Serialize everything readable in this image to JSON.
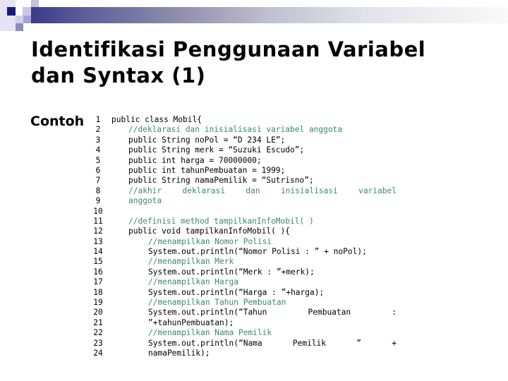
{
  "slide": {
    "title_lines": [
      "Identifikasi Penggunaan Variabel",
      "dan Syntax (1)"
    ],
    "bullet_label": "Contoh",
    "colors": {
      "accent_dark": "#1a1a7a",
      "accent_light": "#c8c8e8",
      "comment": "#3c8a6a"
    }
  },
  "code": {
    "lines": [
      {
        "n": "1",
        "text": "public class Mobil{",
        "type": "code",
        "indent": 0
      },
      {
        "n": "2",
        "text": "//deklarasi dan inisialisasi variabel anggota",
        "type": "comment",
        "indent": 1
      },
      {
        "n": "3",
        "text": "public String noPol = “D 234 LE”;",
        "type": "code",
        "indent": 1
      },
      {
        "n": "4",
        "text": "public String merk = “Suzuki Escudo”;",
        "type": "code",
        "indent": 1
      },
      {
        "n": "5",
        "text": "public int harga = 70000000;",
        "type": "code",
        "indent": 1
      },
      {
        "n": "6",
        "text": "public int tahunPembuatan = 1999;",
        "type": "code",
        "indent": 1
      },
      {
        "n": "7",
        "text": "public String namaPemilik = “Sutrisno”;",
        "type": "code",
        "indent": 1
      },
      {
        "n": "8",
        "text": "//akhir deklarasi dan inisialisasi variabel",
        "type": "comment-justify",
        "indent": 1,
        "parts": [
          "//akhir",
          "deklarasi",
          "dan",
          "inisialisasi",
          "variabel"
        ]
      },
      {
        "n": "9",
        "text": "anggota",
        "type": "comment",
        "indent": 1
      },
      {
        "n": "10",
        "text": "",
        "type": "code",
        "indent": 1
      },
      {
        "n": "11",
        "text": "//definisi method tampilkanInfoMobil( )",
        "type": "comment",
        "indent": 1
      },
      {
        "n": "12",
        "text": "public void tampilkanInfoMobil( ){",
        "type": "code",
        "indent": 1
      },
      {
        "n": "13",
        "text": "//menampilkan Nomor Polisi",
        "type": "comment",
        "indent": 2
      },
      {
        "n": "14",
        "text": "System.out.println(“Nomor Polisi : ” + noPol);",
        "type": "code",
        "indent": 2
      },
      {
        "n": "15",
        "text": "//menampilkan Merk",
        "type": "comment",
        "indent": 2
      },
      {
        "n": "16",
        "text": "System.out.println(“Merk : ”+merk);",
        "type": "code",
        "indent": 2
      },
      {
        "n": "17",
        "text": "//menampilkan Harga",
        "type": "comment",
        "indent": 2
      },
      {
        "n": "18",
        "text": "System.out.println(“Harga : ”+harga);",
        "type": "code",
        "indent": 2
      },
      {
        "n": "19",
        "text": "//menampilkan Tahun Pembuatan",
        "type": "comment",
        "indent": 2
      },
      {
        "n": "20",
        "text": "System.out.println(“Tahun Pembuatan :",
        "type": "code-justify",
        "indent": 2,
        "parts": [
          "System.out.println(“Tahun",
          "Pembuatan",
          ":"
        ]
      },
      {
        "n": "21",
        "text": "”+tahunPembuatan);",
        "type": "code",
        "indent": 2
      },
      {
        "n": "22",
        "text": "//menampilkan Nama Pemilik",
        "type": "comment",
        "indent": 2
      },
      {
        "n": "23",
        "text": "System.out.println(“Nama Pemilik ” +",
        "type": "code-justify",
        "indent": 2,
        "parts": [
          "System.out.println(“Nama",
          "Pemilik",
          "”",
          "+"
        ]
      },
      {
        "n": "24",
        "text": "namaPemilik);",
        "type": "code",
        "indent": 2
      }
    ]
  }
}
